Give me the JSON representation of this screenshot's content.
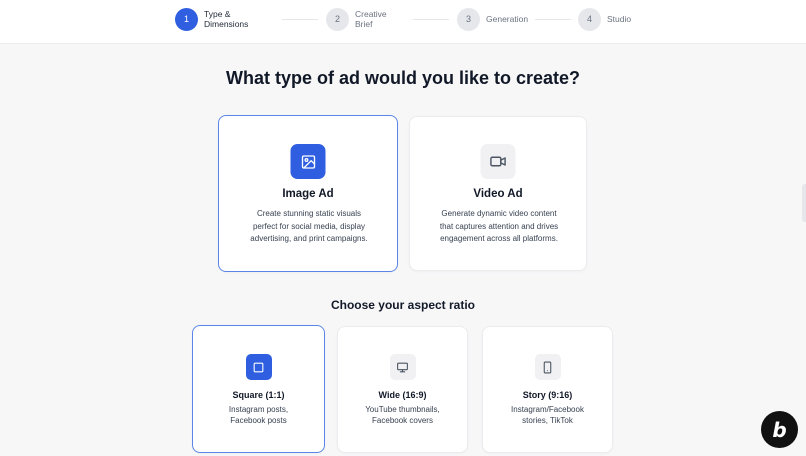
{
  "stepper": {
    "steps": [
      {
        "number": "1",
        "label": "Type &\nDimensions",
        "active": true
      },
      {
        "number": "2",
        "label": "Creative\nBrief",
        "active": false
      },
      {
        "number": "3",
        "label": "Generation",
        "active": false
      },
      {
        "number": "4",
        "label": "Studio",
        "active": false
      }
    ]
  },
  "heading": "What type of ad would you like to create?",
  "ad_types": [
    {
      "title": "Image Ad",
      "description": "Create stunning static visuals perfect for social media, display advertising, and print campaigns.",
      "icon": "image-icon",
      "selected": true
    },
    {
      "title": "Video Ad",
      "description": "Generate dynamic video content that captures attention and drives engagement across all platforms.",
      "icon": "video-camera-icon",
      "selected": false
    }
  ],
  "aspect_heading": "Choose your aspect ratio",
  "aspect_ratios": [
    {
      "title": "Square (1:1)",
      "description": "Instagram posts,\nFacebook posts",
      "icon": "square-icon",
      "selected": true
    },
    {
      "title": "Wide (16:9)",
      "description": "YouTube thumbnails,\nFacebook covers",
      "icon": "monitor-icon",
      "selected": false
    },
    {
      "title": "Story (9:16)",
      "description": "Instagram/Facebook\nstories, TikTok",
      "icon": "smartphone-icon",
      "selected": false
    }
  ],
  "badge": {
    "letter": "b",
    "icon": "bolt-badge-icon"
  },
  "colors": {
    "accent": "#2f5fe0",
    "selected_border": "#5b86e8",
    "background": "#f7f7f8"
  }
}
